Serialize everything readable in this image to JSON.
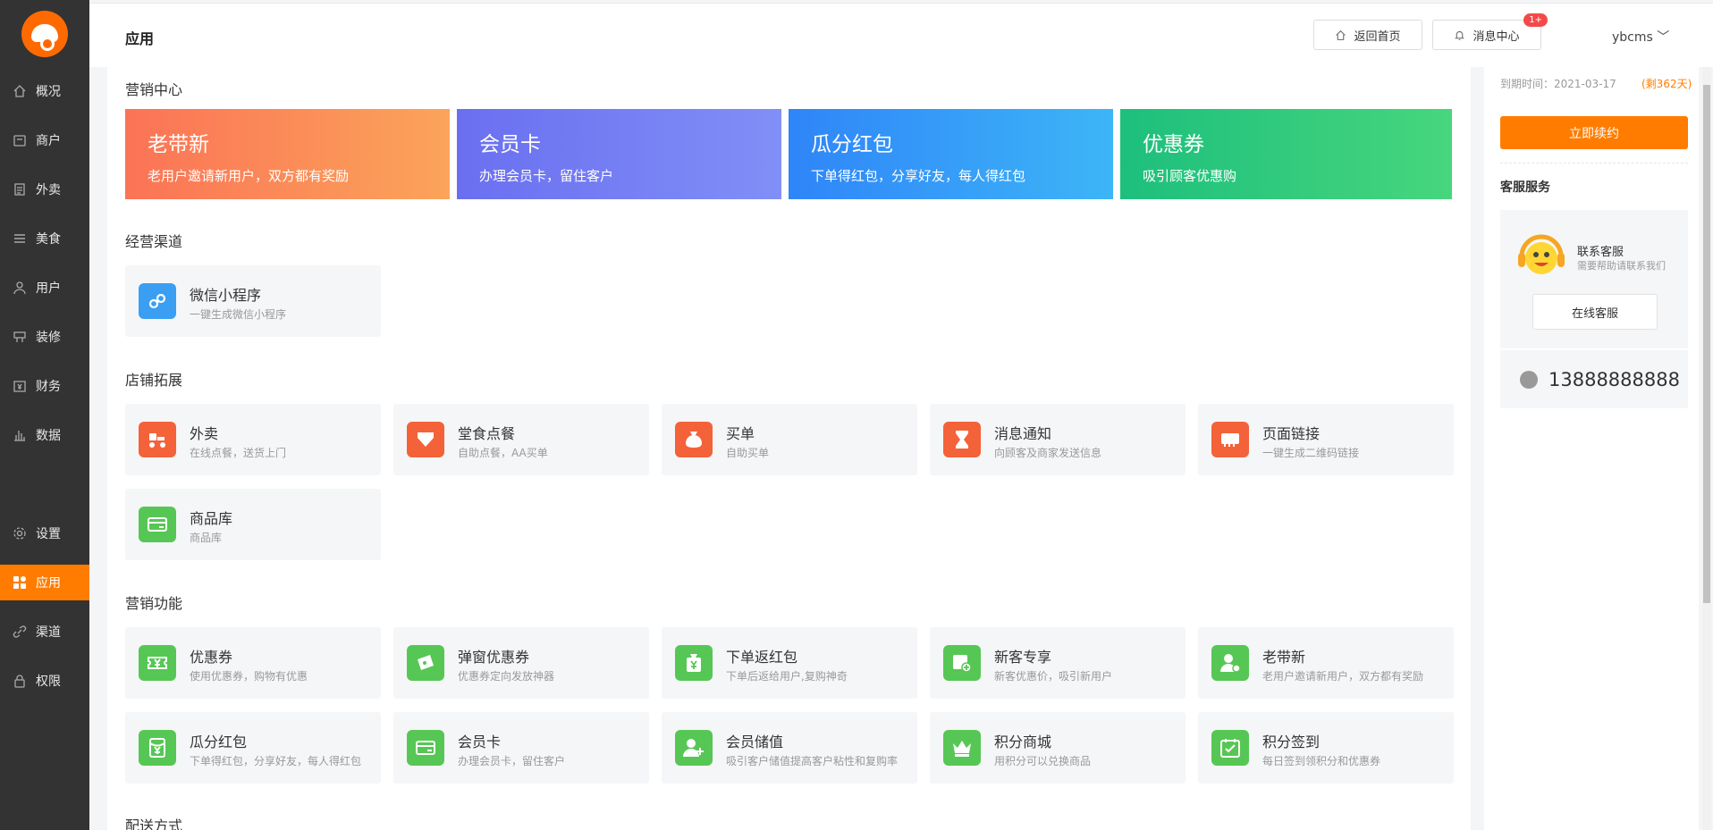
{
  "sidebar": {
    "items": [
      {
        "label": "概况",
        "icon": "home-icon"
      },
      {
        "label": "商户",
        "icon": "store-icon"
      },
      {
        "label": "外卖",
        "icon": "document-icon"
      },
      {
        "label": "美食",
        "icon": "menu-icon"
      },
      {
        "label": "用户",
        "icon": "user-icon"
      },
      {
        "label": "装修",
        "icon": "decorate-icon"
      },
      {
        "label": "财务",
        "icon": "finance-icon"
      },
      {
        "label": "数据",
        "icon": "chart-icon"
      },
      {
        "label": "设置",
        "icon": "gear-icon"
      },
      {
        "label": "应用",
        "icon": "apps-icon",
        "active": true
      },
      {
        "label": "渠道",
        "icon": "link-icon"
      },
      {
        "label": "权限",
        "icon": "lock-icon"
      }
    ]
  },
  "header": {
    "title": "应用",
    "home_label": "返回首页",
    "messages_label": "消息中心",
    "messages_badge": "1+",
    "user_name": "ybcms ﹀"
  },
  "marketing_center": {
    "title": "营销中心",
    "banners": [
      {
        "title": "老带新",
        "subtitle": "老用户邀请新用户，双方都有奖励"
      },
      {
        "title": "会员卡",
        "subtitle": "办理会员卡，留住客户"
      },
      {
        "title": "瓜分红包",
        "subtitle": "下单得红包，分享好友，每人得红包"
      },
      {
        "title": "优惠券",
        "subtitle": "吸引顾客优惠购"
      }
    ]
  },
  "channels": {
    "title": "经营渠道",
    "items": [
      {
        "title": "微信小程序",
        "desc": "一键生成微信小程序"
      }
    ]
  },
  "store_extension": {
    "title": "店铺拓展",
    "items": [
      {
        "title": "外卖",
        "desc": "在线点餐，送货上门"
      },
      {
        "title": "堂食点餐",
        "desc": "自助点餐，AA买单"
      },
      {
        "title": "买单",
        "desc": "自助买单"
      },
      {
        "title": "消息通知",
        "desc": "向顾客及商家发送信息"
      },
      {
        "title": "页面链接",
        "desc": "一键生成二维码链接"
      },
      {
        "title": "商品库",
        "desc": "商品库"
      }
    ]
  },
  "marketing_functions": {
    "title": "营销功能",
    "items": [
      {
        "title": "优惠券",
        "desc": "使用优惠券，购物有优惠"
      },
      {
        "title": "弹窗优惠券",
        "desc": "优惠券定向发放神器"
      },
      {
        "title": "下单返红包",
        "desc": "下单后返给用户,复购神奇"
      },
      {
        "title": "新客专享",
        "desc": "新客优惠价，吸引新用户"
      },
      {
        "title": "老带新",
        "desc": "老用户邀请新用户，双方都有奖励"
      },
      {
        "title": "瓜分红包",
        "desc": "下单得红包，分享好友，每人得红包"
      },
      {
        "title": "会员卡",
        "desc": "办理会员卡，留住客户"
      },
      {
        "title": "会员储值",
        "desc": "吸引客户储值提高客户粘性和复购率"
      },
      {
        "title": "积分商城",
        "desc": "用积分可以兑换商品"
      },
      {
        "title": "积分签到",
        "desc": "每日签到领积分和优惠券"
      }
    ]
  },
  "next_section": {
    "title": "配送方式"
  },
  "right_panel": {
    "expire_label": "到期时间：2021-03-17",
    "days_left": "(剩362天)",
    "renew_label": "立即续约",
    "service_title": "客服服务",
    "contact_name": "联系客服",
    "contact_desc": "需要帮助请联系我们",
    "online_label": "在线客服",
    "phone": "13888888888"
  },
  "colors": {
    "accent": "#ff7c00",
    "sidebar_bg": "#333333",
    "store_icon_bg": "#f4623a",
    "marketing_icon_bg": "#56c754",
    "wechat_icon_bg": "#3a9ff2"
  }
}
